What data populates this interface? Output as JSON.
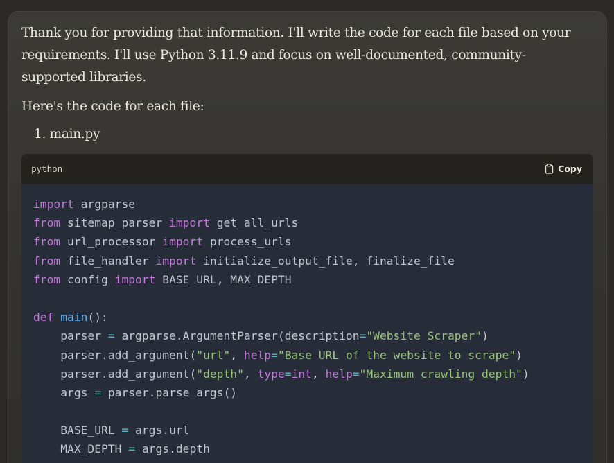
{
  "message": {
    "paragraph1": "Thank you for providing that information. I'll write the code for each file based on your requirements. I'll use Python 3.11.9 and focus on well-documented, community-supported libraries.",
    "paragraph1_lines": [
      "Thank you for providing that information. I'll write the code for each file based on your",
      "requirements. I'll use Python 3.11.9 and focus on well-documented, community-",
      "supported libraries."
    ],
    "paragraph2": "Here's the code for each file:",
    "list_item": "1. main.py"
  },
  "code_block": {
    "language": "python",
    "copy_label": "Copy",
    "lines": [
      [
        {
          "t": "import",
          "c": "kw"
        },
        {
          "t": " argparse",
          "c": "plain"
        }
      ],
      [
        {
          "t": "from",
          "c": "kw"
        },
        {
          "t": " sitemap_parser ",
          "c": "plain"
        },
        {
          "t": "import",
          "c": "kw"
        },
        {
          "t": " get_all_urls",
          "c": "plain"
        }
      ],
      [
        {
          "t": "from",
          "c": "kw"
        },
        {
          "t": " url_processor ",
          "c": "plain"
        },
        {
          "t": "import",
          "c": "kw"
        },
        {
          "t": " process_urls",
          "c": "plain"
        }
      ],
      [
        {
          "t": "from",
          "c": "kw"
        },
        {
          "t": " file_handler ",
          "c": "plain"
        },
        {
          "t": "import",
          "c": "kw"
        },
        {
          "t": " initialize_output_file, finalize_file",
          "c": "plain"
        }
      ],
      [
        {
          "t": "from",
          "c": "kw"
        },
        {
          "t": " config ",
          "c": "plain"
        },
        {
          "t": "import",
          "c": "kw"
        },
        {
          "t": " BASE_URL, MAX_DEPTH",
          "c": "plain"
        }
      ],
      [],
      [
        {
          "t": "def",
          "c": "kw"
        },
        {
          "t": " ",
          "c": "plain"
        },
        {
          "t": "main",
          "c": "fn"
        },
        {
          "t": "():",
          "c": "plain"
        }
      ],
      [
        {
          "t": "    parser ",
          "c": "plain"
        },
        {
          "t": "=",
          "c": "op"
        },
        {
          "t": " argparse.ArgumentParser(description",
          "c": "plain"
        },
        {
          "t": "=",
          "c": "op"
        },
        {
          "t": "\"Website Scraper\"",
          "c": "str"
        },
        {
          "t": ")",
          "c": "plain"
        }
      ],
      [
        {
          "t": "    parser.add_argument(",
          "c": "plain"
        },
        {
          "t": "\"url\"",
          "c": "str"
        },
        {
          "t": ", ",
          "c": "plain"
        },
        {
          "t": "help",
          "c": "kw"
        },
        {
          "t": "=",
          "c": "op"
        },
        {
          "t": "\"Base URL of the website to scrape\"",
          "c": "str"
        },
        {
          "t": ")",
          "c": "plain"
        }
      ],
      [
        {
          "t": "    parser.add_argument(",
          "c": "plain"
        },
        {
          "t": "\"depth\"",
          "c": "str"
        },
        {
          "t": ", ",
          "c": "plain"
        },
        {
          "t": "type",
          "c": "kw"
        },
        {
          "t": "=",
          "c": "op"
        },
        {
          "t": "int",
          "c": "kw"
        },
        {
          "t": ", ",
          "c": "plain"
        },
        {
          "t": "help",
          "c": "kw"
        },
        {
          "t": "=",
          "c": "op"
        },
        {
          "t": "\"Maximum crawling depth\"",
          "c": "str"
        },
        {
          "t": ")",
          "c": "plain"
        }
      ],
      [
        {
          "t": "    args ",
          "c": "plain"
        },
        {
          "t": "=",
          "c": "op"
        },
        {
          "t": " parser.parse_args()",
          "c": "plain"
        }
      ],
      [],
      [
        {
          "t": "    BASE_URL ",
          "c": "plain"
        },
        {
          "t": "=",
          "c": "op"
        },
        {
          "t": " args.url",
          "c": "plain"
        }
      ],
      [
        {
          "t": "    MAX_DEPTH ",
          "c": "plain"
        },
        {
          "t": "=",
          "c": "op"
        },
        {
          "t": " args.depth",
          "c": "plain"
        }
      ]
    ]
  },
  "colors": {
    "keyword": "#c678dd",
    "function": "#61afef",
    "string": "#98c379",
    "operator": "#56b6c2",
    "text": "#c2c7d0",
    "code_bg": "#272d38",
    "header_bg": "#25231f"
  },
  "icons": {
    "copy": "clipboard-icon"
  }
}
